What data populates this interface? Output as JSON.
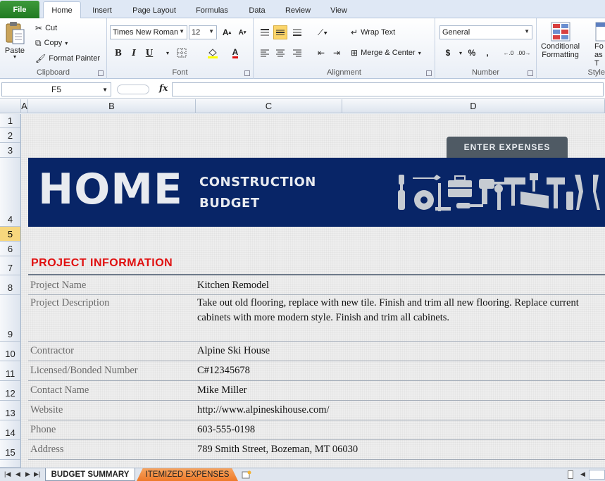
{
  "ribbon_tabs": {
    "file": "File",
    "home": "Home",
    "insert": "Insert",
    "page_layout": "Page Layout",
    "formulas": "Formulas",
    "data": "Data",
    "review": "Review",
    "view": "View"
  },
  "clipboard": {
    "paste": "Paste",
    "cut": "Cut",
    "copy": "Copy",
    "format_painter": "Format Painter",
    "label": "Clipboard"
  },
  "font": {
    "family": "Times New Roman",
    "size": "12",
    "bold": "B",
    "italic": "I",
    "underline": "U",
    "label": "Font"
  },
  "alignment": {
    "wrap_text": "Wrap Text",
    "merge_center": "Merge & Center",
    "label": "Alignment"
  },
  "number": {
    "format": "General",
    "currency": "$",
    "percent": "%",
    "comma": ",",
    "label": "Number"
  },
  "styles": {
    "conditional_line1": "Conditional",
    "conditional_line2": "Formatting",
    "format_table_line1": "Fo",
    "format_table_line2": "as T",
    "label": "Style"
  },
  "formula_bar": {
    "name_box": "F5",
    "fx": "fx",
    "content": ""
  },
  "columns": [
    "A",
    "B",
    "C",
    "D"
  ],
  "rows": [
    "1",
    "2",
    "3",
    "4",
    "5",
    "6",
    "7",
    "8",
    "9",
    "10",
    "11",
    "12",
    "13",
    "14",
    "15"
  ],
  "sheet": {
    "enter_expenses": "ENTER EXPENSES",
    "banner_title": "HOME",
    "banner_sub1": "CONSTRUCTION",
    "banner_sub2": "BUDGET",
    "section_title": "PROJECT INFORMATION",
    "fields": [
      {
        "label": "Project Name",
        "value": "Kitchen Remodel"
      },
      {
        "label": "Project Description",
        "value": "Take out old flooring, replace with new tile.  Finish and trim all new flooring.  Replace current cabinets with more modern style.  Finish and trim all cabinets."
      },
      {
        "label": "Contractor",
        "value": "Alpine Ski House"
      },
      {
        "label": "Licensed/Bonded Number",
        "value": "C#12345678"
      },
      {
        "label": "Contact Name",
        "value": "Mike Miller"
      },
      {
        "label": "Website",
        "value": "http://www.alpineskihouse.com/"
      },
      {
        "label": "Phone",
        "value": "603-555-0198"
      },
      {
        "label": "Address",
        "value": "789 Smith Street, Bozeman, MT 06030"
      }
    ]
  },
  "sheet_tabs": {
    "budget_summary": "BUDGET SUMMARY",
    "itemized_expenses": "ITEMIZED EXPENSES"
  },
  "colors": {
    "banner": "#082567",
    "section_title": "#e01010",
    "enter_button": "#4f5a64",
    "file_tab": "#2e8a2e"
  }
}
